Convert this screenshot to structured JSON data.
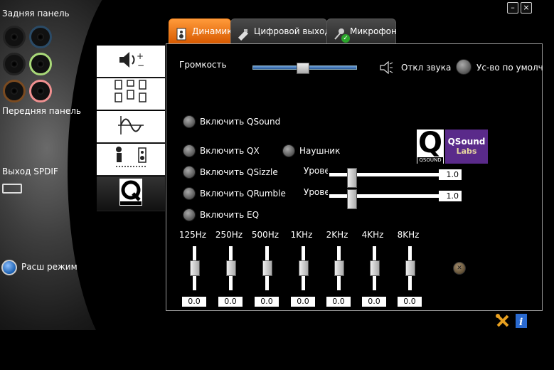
{
  "left": {
    "rear_label": "Задняя панель",
    "front_label": "Передняя панель",
    "spdif_label": "Выход SPDIF",
    "advanced_label": "Расш режим"
  },
  "window": {
    "minimize": "–",
    "close": "×"
  },
  "tabs": [
    {
      "label": "Динамик"
    },
    {
      "label": "Цифровой выход"
    },
    {
      "label": "Микрофон"
    }
  ],
  "volume": {
    "label": "Громкость",
    "level_percent": 48,
    "mute_label": "Откл звука",
    "default_label": "Ус-во по умолч"
  },
  "qsound": {
    "enable_qsound": "Включить QSound",
    "enable_qx": "Включить QX",
    "headphones": "Наушник",
    "enable_qsizzle": "Включить QSizzle",
    "enable_qrumble": "Включить QRumble",
    "enable_eq": "Включить EQ",
    "level_label_1": "Урове",
    "level_label_2": "Урове",
    "level_value_1": "1.0",
    "level_value_2": "1.0",
    "logo_q": "Q",
    "logo_sub": "QSOUND",
    "logo_text_1": "QSound",
    "logo_text_2": "Labs"
  },
  "eq": {
    "bands": [
      {
        "label": "125Hz",
        "value": "0.0"
      },
      {
        "label": "250Hz",
        "value": "0.0"
      },
      {
        "label": "500Hz",
        "value": "0.0"
      },
      {
        "label": "1KHz",
        "value": "0.0"
      },
      {
        "label": "2KHz",
        "value": "0.0"
      },
      {
        "label": "4KHz",
        "value": "0.0"
      },
      {
        "label": "8KHz",
        "value": "0.0"
      }
    ]
  },
  "colors": {
    "accent": "#e86a10",
    "slider_blue": "#4a80c0",
    "logo_bg": "#5a2a8a"
  }
}
